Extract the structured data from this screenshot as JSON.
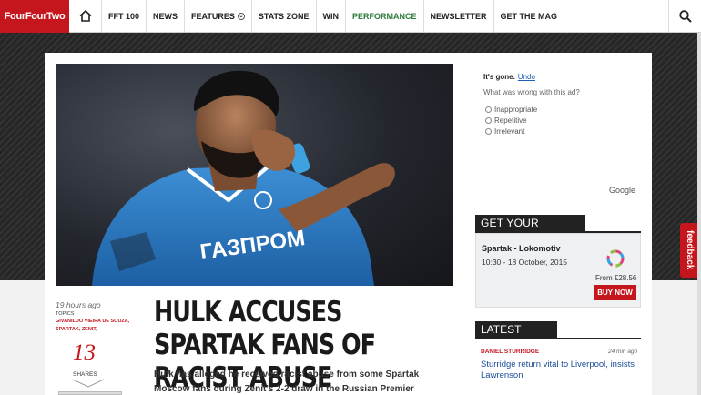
{
  "brand": {
    "logo_text": "FourFourTwo",
    "accent": "#c4161c"
  },
  "nav": {
    "items": [
      {
        "label": "FFT 100"
      },
      {
        "label": "NEWS"
      },
      {
        "label": "FEATURES"
      },
      {
        "label": "STATS ZONE"
      },
      {
        "label": "WIN"
      },
      {
        "label": "PERFORMANCE"
      },
      {
        "label": "NEWSLETTER"
      },
      {
        "label": "GET THE MAG"
      }
    ]
  },
  "ad": {
    "gone_text": "It's gone.",
    "undo_label": "Undo",
    "question": "What was wrong with this ad?",
    "options": [
      "Inappropriate",
      "Repetitive",
      "Irrelevant"
    ],
    "provider": "Google"
  },
  "article": {
    "time_ago": "19 hours ago",
    "topics_label": "TOPICS",
    "tags": "GIVANILDO VIEIRA DE SOUZA, SPARTAK, ZENIT,",
    "share_count": "13",
    "shares_label": "SHARES",
    "headline": "HULK ACCUSES SPARTAK FANS OF RACIST ABUSE",
    "standfirst": "Hulk has alleged he received racist abuse from some Spartak Moscow fans during Zenit's 2-2 draw in the Russian Premier"
  },
  "tickets": {
    "header": "GET YOUR TICKETS",
    "match": "Spartak - Lokomotiv",
    "datetime": "10:30 - 18 October, 2015",
    "price": "From £28.56",
    "buy_label": "BUY NOW"
  },
  "latest_news": {
    "header": "LATEST NEWS",
    "items": [
      {
        "tag": "DANIEL STURRIDGE",
        "time": "24 min ago",
        "title": "Sturridge return vital to Liverpool, insists Lawrenson"
      }
    ]
  },
  "feedback_label": "feedback"
}
